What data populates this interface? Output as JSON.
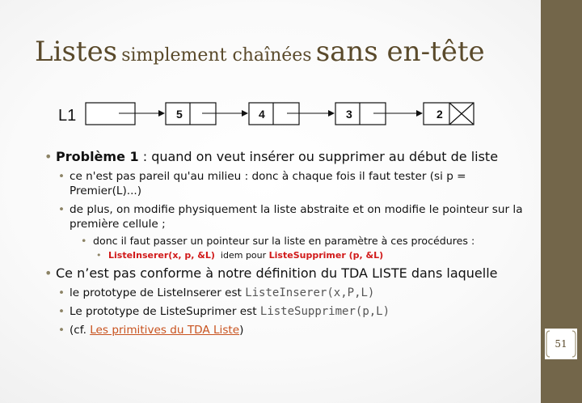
{
  "title": {
    "part1": "Listes",
    "part2": "simplement chaînées",
    "part3": "sans en-tête"
  },
  "diagram": {
    "list_name": "L1",
    "cells": [
      "5",
      "4",
      "3",
      "2"
    ]
  },
  "bullets": {
    "p1_bold": "Problème 1",
    "p1_rest": " : quand on veut insérer ou supprimer au début de liste",
    "p1_sub1": "ce n'est pas pareil qu'au milieu : donc à chaque fois il faut tester (si p = Premier(L)...)",
    "p1_sub2": "de plus, on modifie physiquement la liste abstraite et on modifie le pointeur sur la première cellule ;",
    "p1_sub3": "donc il faut passer un pointeur sur la liste en paramètre à ces procédures :",
    "p1_sub4_red1": "ListeInserer(x, p, &L)",
    "p1_sub4_mid": "  idem pour ",
    "p1_sub4_red2": "ListeSupprimer (p, &L)",
    "p2_text": "Ce n’est pas conforme à notre définition du TDA LISTE dans laquelle",
    "p2_sub1_text": " le prototype de ListeInserer est ",
    "p2_sub1_code": "ListeInserer(x,P,L)",
    "p2_sub2_text": "Le prototype de ListeSuprimer est ",
    "p2_sub2_code": "ListeSupprimer(p,L)",
    "p2_sub3_pre": "(cf. ",
    "p2_sub3_link": "Les primitives du TDA Liste",
    "p2_sub3_post": ")"
  },
  "page_number": "51",
  "colors": {
    "sidebar": "#73664a",
    "title": "#5a4a2b",
    "accent_red": "#d11a1a",
    "link": "#c8521e"
  }
}
